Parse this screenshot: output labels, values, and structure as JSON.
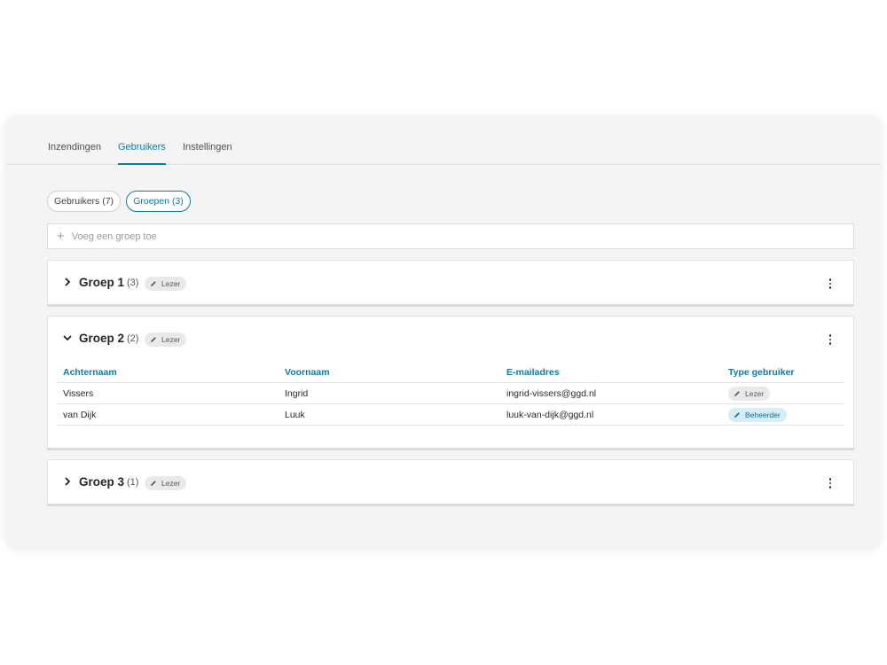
{
  "tabs": [
    {
      "label": "Inzendingen",
      "active": false
    },
    {
      "label": "Gebruikers",
      "active": true
    },
    {
      "label": "Instellingen",
      "active": false
    }
  ],
  "filters": {
    "users_label": "Gebruikers (7)",
    "groups_label": "Groepen (3)",
    "selected": "Groepen (3)"
  },
  "add_group": {
    "placeholder": "Voeg een groep toe"
  },
  "groups": [
    {
      "name": "Groep 1",
      "count": "(3)",
      "role": "Lezer",
      "expanded": false
    },
    {
      "name": "Groep 2",
      "count": "(2)",
      "role": "Lezer",
      "expanded": true,
      "columns": [
        "Achternaam",
        "Voornaam",
        "E-mailadres",
        "Type gebruiker"
      ],
      "members": [
        {
          "last_name": "Vissers",
          "first_name": "Ingrid",
          "email": "ingrid-vissers@ggd.nl",
          "type": "Lezer"
        },
        {
          "last_name": "van Dijk",
          "first_name": "Luuk",
          "email": "luuk-van-dijk@ggd.nl",
          "type": "Beheerder"
        }
      ]
    },
    {
      "name": "Groep 3",
      "count": "(1)",
      "role": "Lezer",
      "expanded": false
    }
  ],
  "colors": {
    "accent": "#0e7aa8",
    "badge_default": "#ebe8ec",
    "badge_admin": "#d6edf7"
  },
  "icons": {
    "expand": "chevron-right-icon",
    "collapse": "chevron-down-icon",
    "role": "pencil-icon",
    "menu": "more-vertical-icon",
    "add": "plus-icon"
  }
}
